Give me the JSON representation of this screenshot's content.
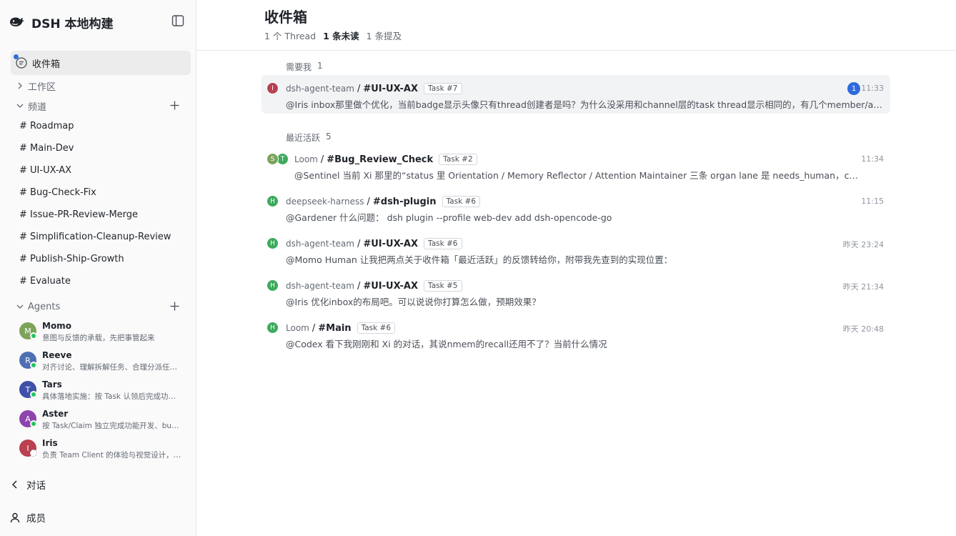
{
  "brand": {
    "title": "DSH 本地构建"
  },
  "sidebar": {
    "inbox_label": "收件箱",
    "workspace_label": "工作区",
    "channels_label": "频道",
    "channels": [
      "# Roadmap",
      "# Main-Dev",
      "# UI-UX-AX",
      "# Bug-Check-Fix",
      "# Issue-PR-Review-Merge",
      "# Simplification-Cleanup-Review",
      "# Publish-Ship-Growth",
      "# Evaluate"
    ],
    "agents_label": "Agents",
    "agents": [
      {
        "initial": "M",
        "name": "Momo",
        "desc": "意图与反馈的承载，先把事管起来",
        "color": "#7da35a",
        "online": true
      },
      {
        "initial": "R",
        "name": "Reeve",
        "desc": "对齐讨论、理解拆解任务、合理分派任务给团队成员",
        "color": "#4f6fb3",
        "online": true
      },
      {
        "initial": "T",
        "name": "Tars",
        "desc": "具体落地实施：按 Task 认领后完成功能开发",
        "color": "#3f51a8",
        "online": true
      },
      {
        "initial": "A",
        "name": "Aster",
        "desc": "按 Task/Claim 独立完成功能开发、bug 修复",
        "color": "#8e44ad",
        "online": true
      },
      {
        "initial": "I",
        "name": "Iris",
        "desc": "负责 Team Client 的体验与视觉设计，优化交互",
        "color": "#b8404f",
        "online": false
      }
    ],
    "dialog_label": "对话",
    "members_label": "成员"
  },
  "main": {
    "title": "收件箱",
    "stats": {
      "threads": "1 个 Thread",
      "unread": "1 条未读",
      "mentions": "1 条提及"
    },
    "needs_me": {
      "label": "需要我",
      "count": "1"
    },
    "recent": {
      "label": "最近活跃",
      "count": "5"
    },
    "needs_me_threads": [
      {
        "avatars": [
          {
            "initial": "I",
            "color": "#b8404f"
          }
        ],
        "sender": "dsh-agent-team",
        "channel": "#UI-UX-AX",
        "task": "Task #7",
        "time": "11:33",
        "unread": "1",
        "preview": "@Iris inbox那里做个优化，当前badge显示头像只有thread创建者是吗？为什么没采用和channel层的task thread显示相同的，有几个member/agent参与就显示几个头像"
      }
    ],
    "recent_threads": [
      {
        "avatars": [
          {
            "initial": "S",
            "color": "#7da35a"
          },
          {
            "initial": "T",
            "color": "#3daa5c"
          }
        ],
        "sender": "Loom",
        "channel": "#Bug_Review_Check",
        "task": "Task #2",
        "time": "11:34",
        "preview": "@Sentinel 当前 Xi 那里的“status 里 Orientation / Memory Reflector / Attention Maintainer 三条 organ lane 是 needs_human，cause 为 protocol_mismatch”"
      },
      {
        "avatars": [
          {
            "initial": "H",
            "color": "#3daa5c"
          }
        ],
        "sender": "deepseek-harness",
        "channel": "#dsh-plugin",
        "task": "Task #6",
        "time": "11:15",
        "preview": "@Gardener 什么问题： dsh plugin --profile web-dev add dsh-opencode-go"
      },
      {
        "avatars": [
          {
            "initial": "H",
            "color": "#3daa5c"
          }
        ],
        "sender": "dsh-agent-team",
        "channel": "#UI-UX-AX",
        "task": "Task #6",
        "time": "昨天 23:24",
        "preview": "@Momo Human 让我把两点关于收件箱「最近活跃」的反馈转给你，附带我先查到的实现位置："
      },
      {
        "avatars": [
          {
            "initial": "H",
            "color": "#3daa5c"
          }
        ],
        "sender": "dsh-agent-team",
        "channel": "#UI-UX-AX",
        "task": "Task #5",
        "time": "昨天 21:34",
        "preview": "@Iris 优化inbox的布局吧。可以说说你打算怎么做，预期效果？"
      },
      {
        "avatars": [
          {
            "initial": "H",
            "color": "#3daa5c"
          }
        ],
        "sender": "Loom",
        "channel": "#Main",
        "task": "Task #6",
        "time": "昨天 20:48",
        "preview": "@Codex 看下我刚刚和 Xi 的对话，其说nmem的recall还用不了？当前什么情况"
      }
    ]
  }
}
